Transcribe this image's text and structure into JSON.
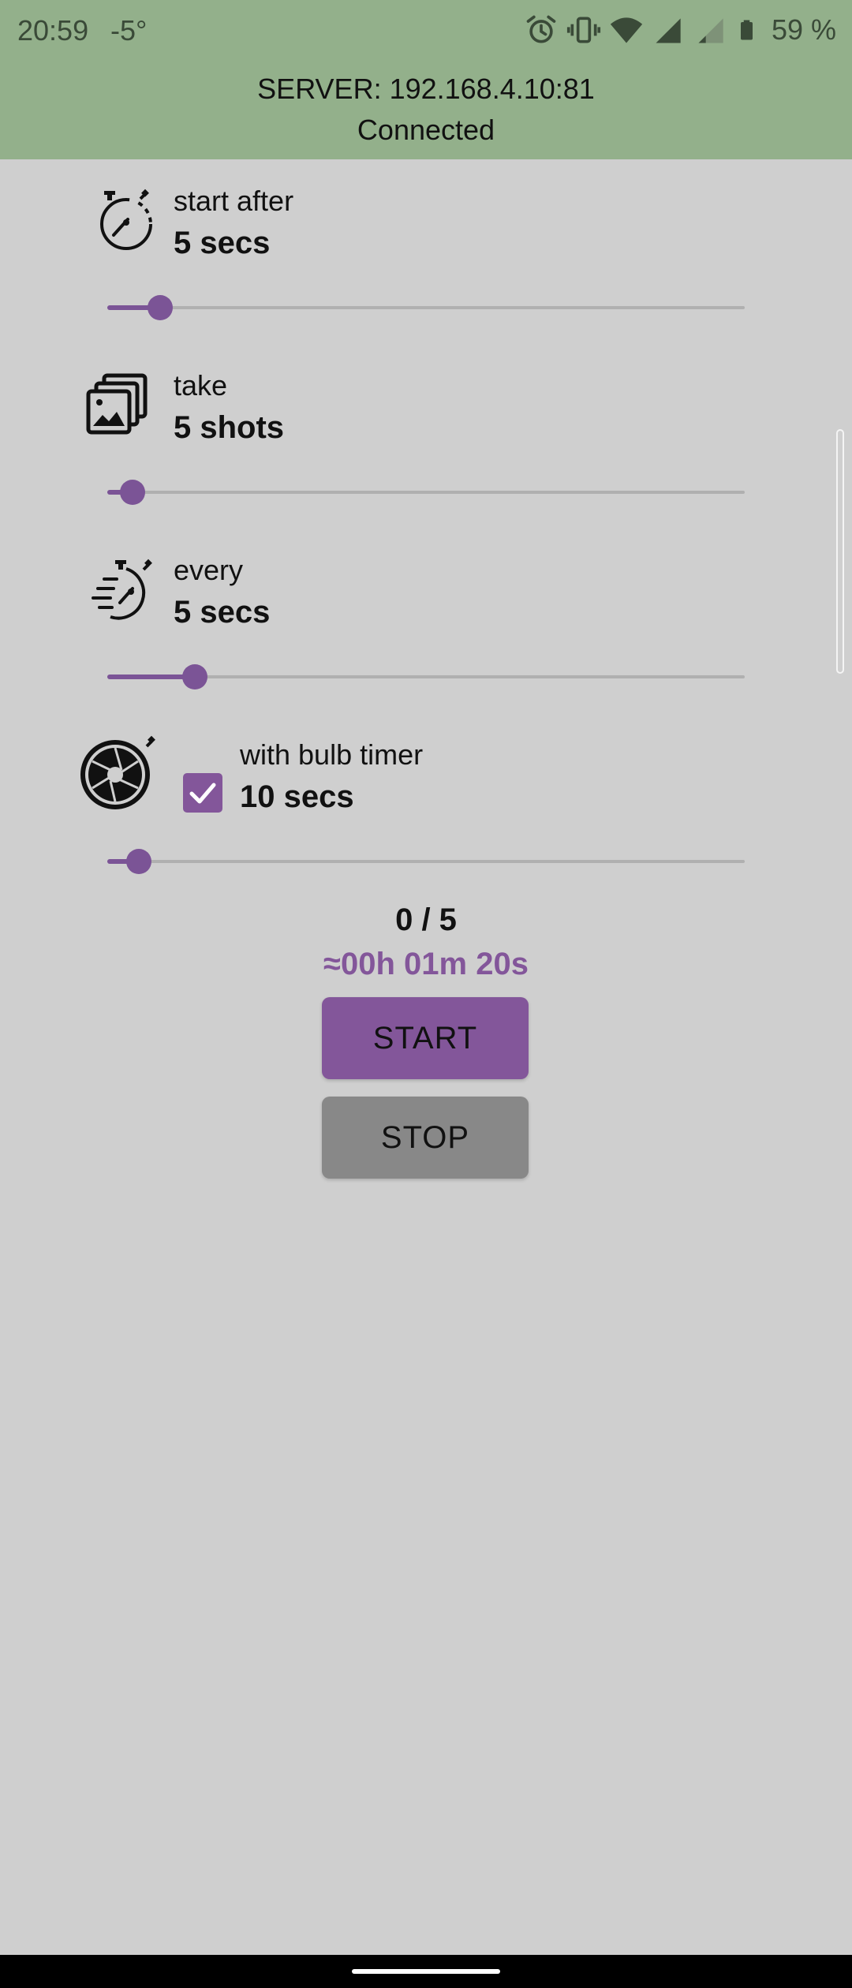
{
  "status_bar": {
    "time": "20:59",
    "temperature": "-5°",
    "battery_percent": "59 %",
    "icons": [
      "alarm-icon",
      "vibrate-icon",
      "wifi-icon",
      "signal-icon",
      "signal-icon",
      "battery-icon"
    ]
  },
  "server": {
    "address_line": "SERVER: 192.168.4.10:81",
    "status": "Connected"
  },
  "settings": {
    "start_after": {
      "label": "start after",
      "value": "5 secs",
      "slider_fraction": 0.083,
      "icon": "stopwatch-icon"
    },
    "take": {
      "label": "take",
      "value": "5 shots",
      "slider_fraction": 0.04,
      "icon": "photos-stack-icon"
    },
    "every": {
      "label": "every",
      "value": "5 secs",
      "slider_fraction": 0.137,
      "icon": "fast-stopwatch-icon"
    },
    "bulb": {
      "label": "with bulb timer",
      "value": "10 secs",
      "checked": true,
      "slider_fraction": 0.05,
      "icon": "aperture-icon"
    }
  },
  "progress": {
    "count": "0 / 5",
    "eta": "≈00h 01m 20s"
  },
  "buttons": {
    "start": "START",
    "stop": "STOP"
  },
  "colors": {
    "header": "#93b08b",
    "background": "#cfcfcf",
    "accent": "#83569a",
    "stop_button": "#888888"
  }
}
